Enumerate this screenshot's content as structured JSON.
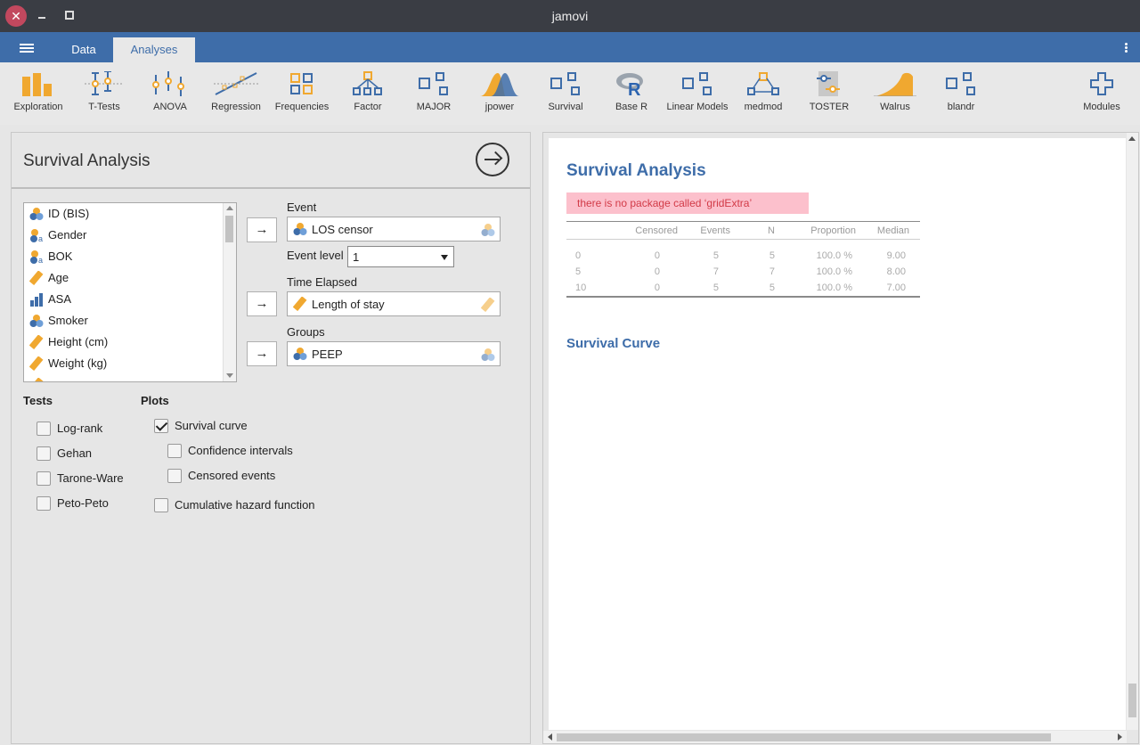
{
  "window": {
    "title": "jamovi"
  },
  "tabs": {
    "data": "Data",
    "analyses": "Analyses"
  },
  "ribbon": {
    "items": [
      "Exploration",
      "T-Tests",
      "ANOVA",
      "Regression",
      "Frequencies",
      "Factor",
      "MAJOR",
      "jpower",
      "Survival",
      "Base R",
      "Linear Models",
      "medmod",
      "TOSTER",
      "Walrus",
      "blandr"
    ],
    "modules": "Modules"
  },
  "options": {
    "title": "Survival Analysis",
    "variables": [
      "ID (BIS)",
      "Gender",
      "BOK",
      "Age",
      "ASA",
      "Smoker",
      "Height (cm)",
      "Weight (kg)"
    ],
    "event": {
      "label": "Event",
      "value": "LOS censor"
    },
    "event_level": {
      "label": "Event level",
      "value": "1"
    },
    "time": {
      "label": "Time Elapsed",
      "value": "Length of stay"
    },
    "groups": {
      "label": "Groups",
      "value": "PEEP"
    },
    "arrow": "→",
    "tests": {
      "heading": "Tests",
      "items": [
        "Log-rank",
        "Gehan",
        "Tarone-Ware",
        "Peto-Peto"
      ]
    },
    "plots": {
      "heading": "Plots",
      "survival_curve": "Survival curve",
      "confidence_intervals": "Confidence intervals",
      "censored_events": "Censored events",
      "cumulative_hazard": "Cumulative hazard function"
    }
  },
  "results": {
    "title": "Survival Analysis",
    "error": "there is no package called ‘gridExtra’",
    "table": {
      "headers": [
        "Censored",
        "Events",
        "N",
        "Proportion",
        "Median"
      ],
      "rows": [
        [
          "0",
          "0",
          "5",
          "5",
          "100.0 %",
          "9.00"
        ],
        [
          "5",
          "0",
          "7",
          "7",
          "100.0 %",
          "8.00"
        ],
        [
          "10",
          "0",
          "5",
          "5",
          "100.0 %",
          "7.00"
        ]
      ]
    },
    "subtitle": "Survival Curve"
  },
  "colors": {
    "accent": "#3e6da9",
    "titlebar": "#3a3d44",
    "error_bg": "#fcc0cc",
    "error_text": "#d23a47",
    "icon_orange": "#f0a830",
    "icon_blue": "#3e6da9"
  }
}
